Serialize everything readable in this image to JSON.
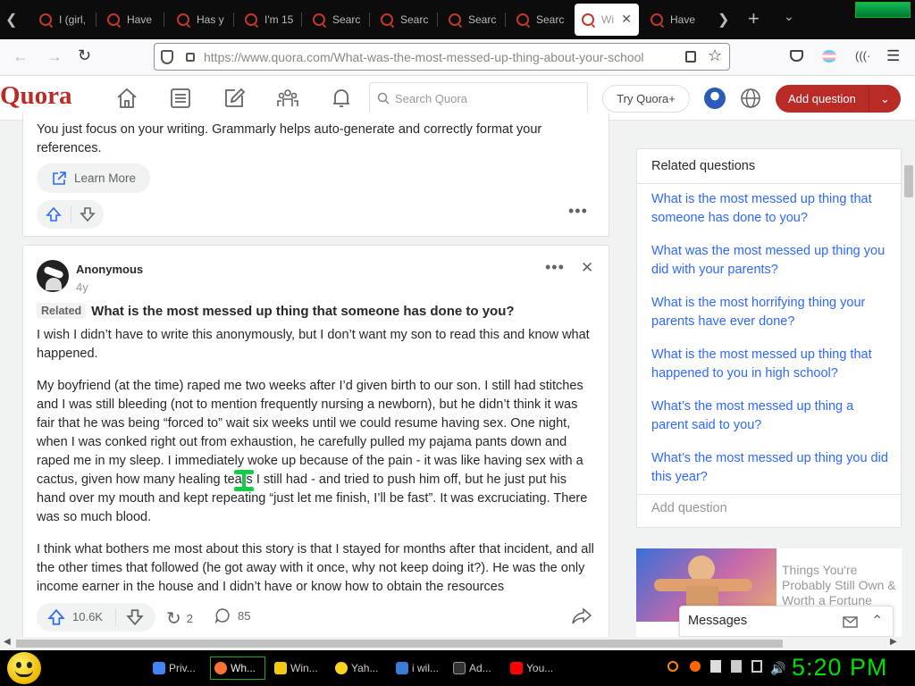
{
  "tabs": [
    {
      "label": "I (girl,"
    },
    {
      "label": "Have"
    },
    {
      "label": "Has y"
    },
    {
      "label": "I'm 15"
    },
    {
      "label": "Searc"
    },
    {
      "label": "Searc"
    },
    {
      "label": "Searc"
    },
    {
      "label": "Searc"
    },
    {
      "label": "Wi"
    },
    {
      "label": "Have"
    }
  ],
  "nav": {
    "url_host": "https://www.quora.com",
    "url_path": "/What-was-the-most-messed-up-thing-about-your-school"
  },
  "header": {
    "logo": "Quora",
    "search_placeholder": "Search Quora",
    "try_label": "Try Quora+",
    "add_question": "Add question"
  },
  "ad": {
    "text": "You just focus on your writing. Grammarly helps auto-generate and correctly format your references.",
    "learn_more": "Learn More"
  },
  "answer": {
    "author": "Anonymous",
    "time": "4y",
    "related_tag": "Related",
    "question": "What is the most messed up thing that someone has done to you?",
    "paragraphs": [
      "I wish I didn’t have to write this anonymously, but I don’t want my son to read this and know what happened.",
      "My boyfriend (at the time) raped me two weeks after I’d given birth to our son. I still had stitches and I was still bleeding (not to mention frequently nursing a newborn), but he didn’t think it was fair that he was being “forced to” wait six weeks until we could resume having sex. One night, when I was conked right out from exhaustion, he carefully pulled my pajama pants down and raped me in my sleep. I immediately woke up because of the pain - it was like having sex with a cactus, given how many healing tears I still had - and tried to push him off, but he just put his hand over my mouth and kept repeating “just let me finish, I’ll be fast”. It was excruciating. There was so much blood.",
      "I think what bothers me most about this story is that I stayed for months after that incident, and all the other times that followed (he got away with it once, why not keep doing it?). He was the only income earner in the house and I didn’t have or know how to obtain the resources"
    ],
    "upvotes": "10.6K",
    "shares": "2",
    "comments": "85"
  },
  "related": {
    "title": "Related questions",
    "items": [
      "What is the most messed up thing that someone has done to you?",
      "What was the most messed up thing you did with your parents?",
      "What is the most horrifying thing your parents have ever done?",
      "What is the most messed up thing that happened to you in high school?",
      "What’s the most messed up thing a parent said to you?",
      "What’s the most messed up thing you did this year?"
    ],
    "add_question": "Add question"
  },
  "promo": {
    "text": "Things You're Probably Still Own & Worth a Fortune"
  },
  "messages": {
    "label": "Messages"
  },
  "taskbar": {
    "items": [
      {
        "label": "Priv...",
        "color": "#4285f4"
      },
      {
        "label": "Wh...",
        "color": "#ff7139"
      },
      {
        "label": "Win...",
        "color": "#f2c811"
      },
      {
        "label": "Yah...",
        "color": "#ffd21f"
      },
      {
        "label": "i wil...",
        "color": "#3a7bd5"
      },
      {
        "label": "Ad...",
        "color": "#333333"
      },
      {
        "label": "You...",
        "color": "#ff0000"
      }
    ],
    "clock": "5:20 PM"
  },
  "colors": {
    "brand": "#b92b27",
    "link": "#2e69ff",
    "clock": "#00e000"
  }
}
